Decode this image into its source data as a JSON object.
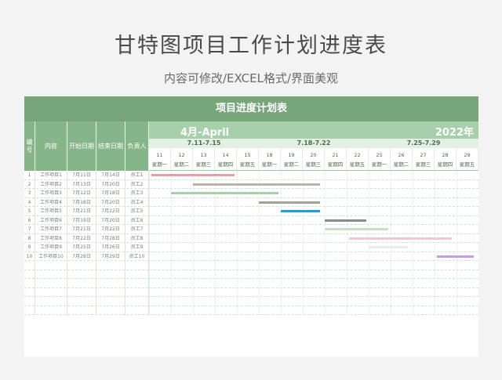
{
  "header": {
    "title": "甘特图项目工作计划进度表",
    "subtitle": "内容可修改/EXCEL格式/界面美观"
  },
  "sheet": {
    "title": "项目进度计划表",
    "columns": [
      "编号",
      "内容",
      "开始日期",
      "结束日期",
      "负责人"
    ],
    "month_label": "4月-April",
    "year_label": "2022年",
    "weeks": [
      "7.11-7.15",
      "7.18-7.22",
      "7.25-7.29"
    ],
    "days": [
      {
        "n": "11",
        "w": "星期一"
      },
      {
        "n": "12",
        "w": "星期二"
      },
      {
        "n": "13",
        "w": "星期三"
      },
      {
        "n": "14",
        "w": "星期四"
      },
      {
        "n": "15",
        "w": "星期五"
      },
      {
        "n": "18",
        "w": "星期一"
      },
      {
        "n": "19",
        "w": "星期二"
      },
      {
        "n": "20",
        "w": "星期三"
      },
      {
        "n": "21",
        "w": "星期四"
      },
      {
        "n": "22",
        "w": "星期五"
      },
      {
        "n": "25",
        "w": "星期一"
      },
      {
        "n": "26",
        "w": "星期二"
      },
      {
        "n": "27",
        "w": "星期三"
      },
      {
        "n": "28",
        "w": "星期四"
      },
      {
        "n": "29",
        "w": "星期五"
      }
    ],
    "rows": [
      {
        "id": "1",
        "item": "工作项目1",
        "start": "7月11日",
        "end": "7月14日",
        "owner": "员工1",
        "bar_color": "#e4a0a8",
        "bar_start": 0.1,
        "bar_end": 3.9
      },
      {
        "id": "2",
        "item": "工作项目2",
        "start": "7月13日",
        "end": "7月20日",
        "owner": "员工2",
        "bar_color": "#b8b4a8",
        "bar_start": 2.0,
        "bar_end": 7.8
      },
      {
        "id": "3",
        "item": "工作项目3",
        "start": "7月12日",
        "end": "7月18日",
        "owner": "员工3",
        "bar_color": "#a9cfa6",
        "bar_start": 1.0,
        "bar_end": 5.9
      },
      {
        "id": "4",
        "item": "工作项目4",
        "start": "7月18日",
        "end": "7月20日",
        "owner": "员工4",
        "bar_color": "#a5a493",
        "bar_start": 5.0,
        "bar_end": 7.8
      },
      {
        "id": "5",
        "item": "工作项目5",
        "start": "7月21日",
        "end": "7月22日",
        "owner": "员工5",
        "bar_color": "#1f9ed8",
        "bar_start": 6.0,
        "bar_end": 7.8
      },
      {
        "id": "6",
        "item": "工作项目6",
        "start": "7月19日",
        "end": "7月20日",
        "owner": "员工6",
        "bar_color": "#8c8c8c",
        "bar_start": 8.0,
        "bar_end": 9.9
      },
      {
        "id": "7",
        "item": "工作项目7",
        "start": "7月21日",
        "end": "7月22日",
        "owner": "员工7",
        "bar_color": "#c9dcc5",
        "bar_start": 8.0,
        "bar_end": 10.9
      },
      {
        "id": "8",
        "item": "工作项目8",
        "start": "7月22日",
        "end": "7月28日",
        "owner": "员工8",
        "bar_color": "#f2c6cc",
        "bar_start": 9.1,
        "bar_end": 13.8
      },
      {
        "id": "9",
        "item": "工作项目9",
        "start": "7月25日",
        "end": "7月26日",
        "owner": "员工9",
        "bar_color": "#e6ecec",
        "bar_start": 10.0,
        "bar_end": 11.8
      },
      {
        "id": "10",
        "item": "工作项目10",
        "start": "7月28日",
        "end": "7月29日",
        "owner": "员工10",
        "bar_color": "#c49ee0",
        "bar_start": 13.1,
        "bar_end": 14.8
      }
    ]
  }
}
